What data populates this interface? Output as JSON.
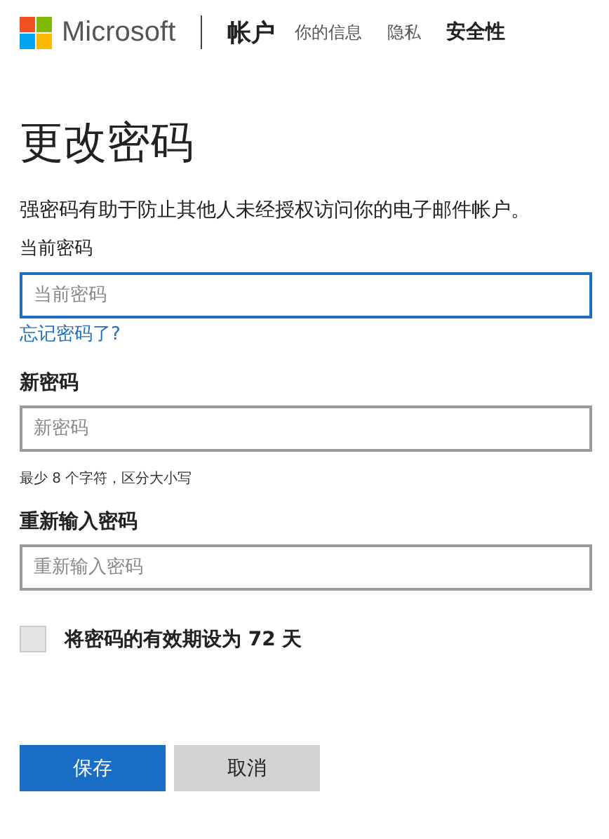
{
  "header": {
    "brand": "Microsoft",
    "section": "帐户",
    "nav": [
      {
        "label": "你的信息",
        "selected": false
      },
      {
        "label": "隐私",
        "selected": false
      },
      {
        "label": "安全性",
        "selected": true
      }
    ]
  },
  "title": "更改密码",
  "description": "强密码有助于防止其他人未经授权访问你的电子邮件帐户。",
  "fields": [
    {
      "label": "当前密码",
      "placeholder": "当前密码",
      "focused": true,
      "link": "忘记密码了?"
    },
    {
      "label": "新密码",
      "placeholder": "新密码",
      "focused": false,
      "hint": "最少 8 个字符，区分大小写"
    },
    {
      "label": "重新输入密码",
      "placeholder": "重新输入密码",
      "focused": false
    }
  ],
  "checkbox": {
    "label": "将密码的有效期设为 72 天",
    "checked": false
  },
  "buttons": [
    {
      "label": "保存",
      "kind": "primary"
    },
    {
      "label": "取消",
      "kind": "secondary"
    }
  ]
}
